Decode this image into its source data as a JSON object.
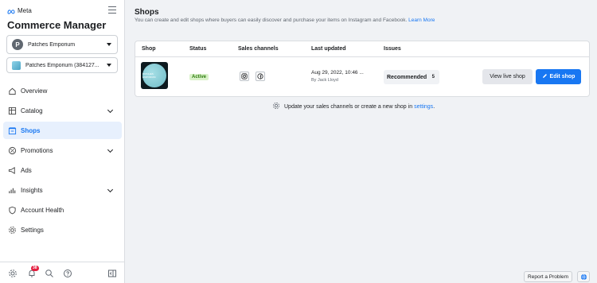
{
  "brand": {
    "logo_text": "Meta",
    "app_title": "Commerce Manager"
  },
  "account_select": {
    "avatar_letter": "P",
    "value": "Patches Emporium"
  },
  "catalog_select": {
    "value": "Patches Emporium (384127..."
  },
  "nav": {
    "items": [
      {
        "label": "Overview",
        "icon": "home-icon"
      },
      {
        "label": "Catalog",
        "icon": "catalog-icon"
      },
      {
        "label": "Shops",
        "icon": "shop-icon",
        "active": true
      },
      {
        "label": "Promotions",
        "icon": "promotions-icon"
      },
      {
        "label": "Ads",
        "icon": "megaphone-icon"
      },
      {
        "label": "Insights",
        "icon": "bar-chart-icon"
      },
      {
        "label": "Account Health",
        "icon": "heart-shield-icon"
      },
      {
        "label": "Settings",
        "icon": "gear-icon"
      }
    ]
  },
  "sidebar_footer": {
    "notification_count": "38"
  },
  "page": {
    "title": "Shops",
    "description": "You can create and edit shops where buyers can easily discover and purchase your items on Instagram and Facebook.",
    "learn_more": "Learn More"
  },
  "table": {
    "headers": {
      "shop": "Shop",
      "status": "Status",
      "channels": "Sales channels",
      "updated": "Last updated",
      "issues": "Issues"
    },
    "row": {
      "thumb_text": "PATCHES EMPORIUM",
      "status": "Active",
      "channels": [
        "instagram-icon",
        "facebook-icon"
      ],
      "updated": "Aug 29, 2022, 10:46 ...",
      "updated_by": "By Jack Lloyd",
      "issue_label": "Recommended",
      "issue_count": "5",
      "view_label": "View live shop",
      "edit_label": "Edit shop"
    }
  },
  "hint": {
    "text": "Update your sales channels or create a new shop in",
    "link": "settings",
    "end": "."
  },
  "footer": {
    "report_label": "Report a Problem"
  },
  "colors": {
    "accent": "#1877f2",
    "active_bg": "#e7f0fd",
    "status_bg": "#d9f2c9",
    "status_fg": "#2b7a0b",
    "badge": "#e41e3f"
  }
}
